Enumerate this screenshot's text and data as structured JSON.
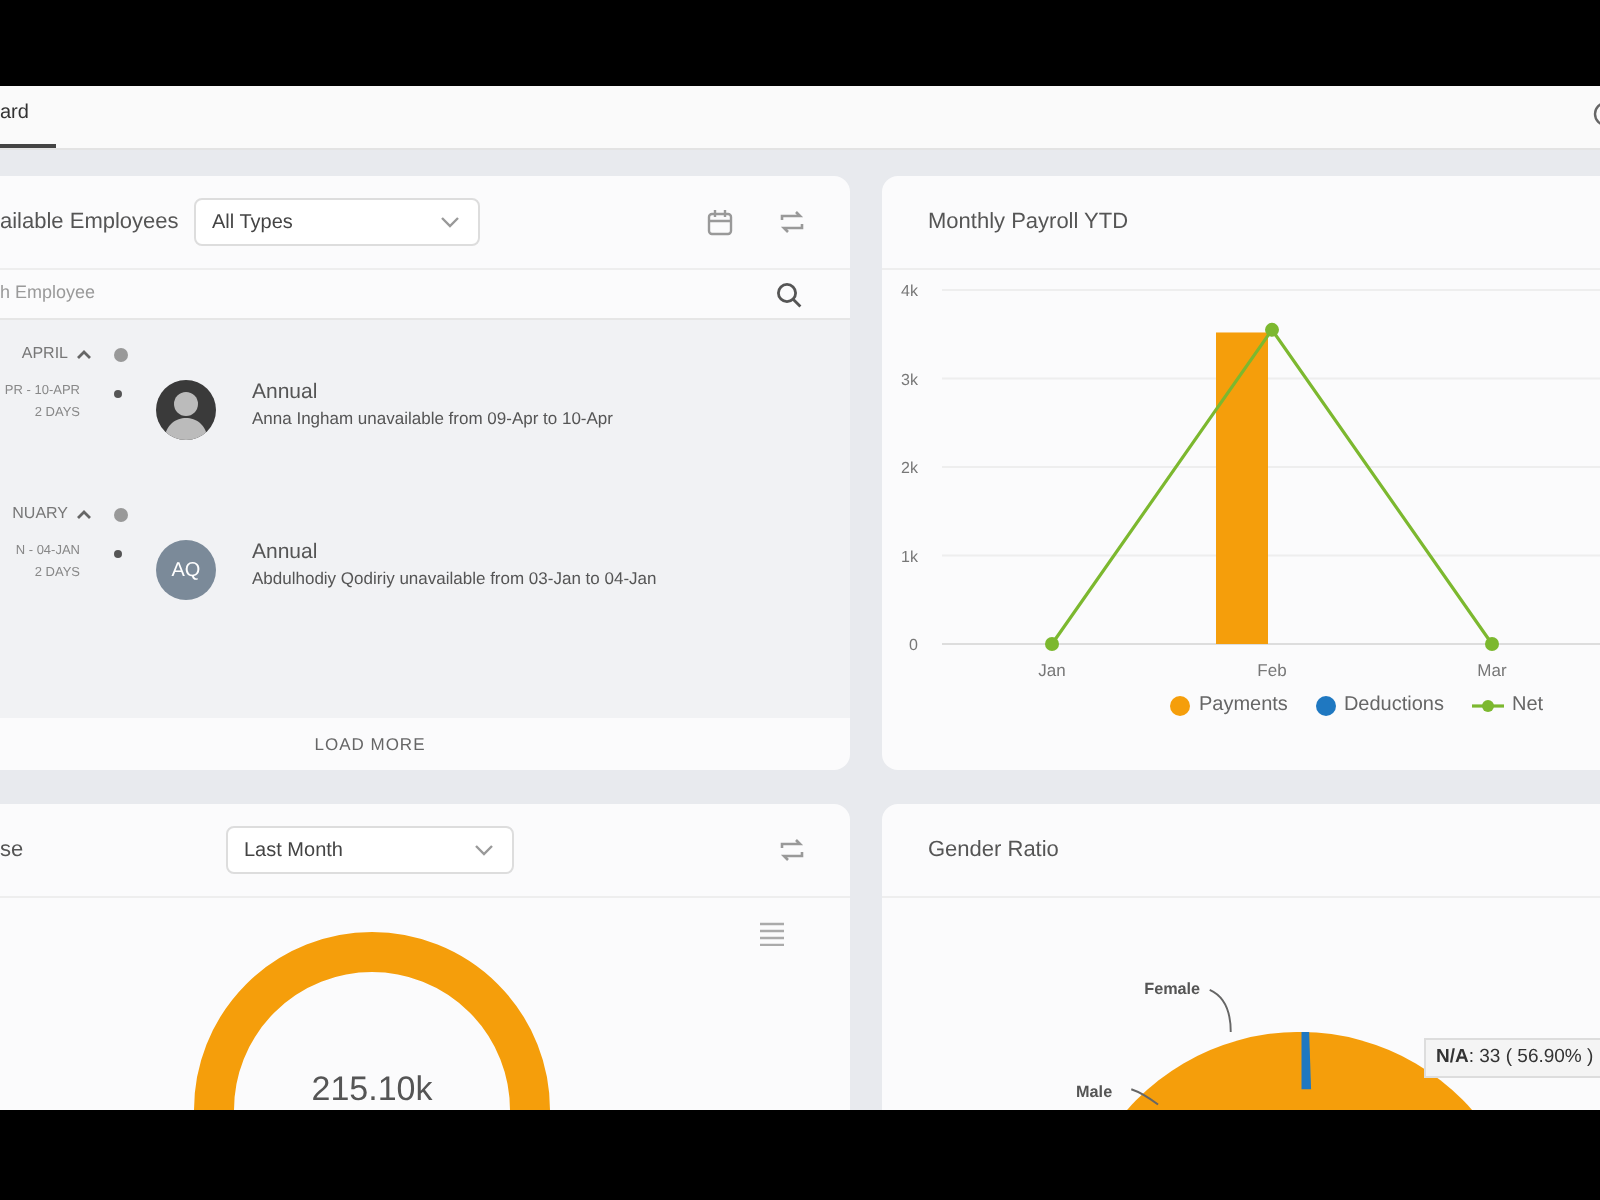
{
  "tabs": [
    {
      "label": "ard",
      "selected": true
    }
  ],
  "unavailable_card": {
    "title": "ailable Employees",
    "type_filter": {
      "value": "All Types"
    },
    "search": {
      "placeholder": "h Employee"
    },
    "groups": [
      {
        "month": "APRIL",
        "expanded": true,
        "entries": [
          {
            "dates": "PR - 10-APR",
            "duration": "2 DAYS",
            "avatar": {
              "kind": "photo"
            },
            "leave_type": "Annual",
            "description": "Anna Ingham unavailable from 09-Apr to 10-Apr"
          }
        ]
      },
      {
        "month": "NUARY",
        "expanded": true,
        "entries": [
          {
            "dates": "N - 04-JAN",
            "duration": "2 DAYS",
            "avatar": {
              "kind": "initials",
              "initials": "AQ"
            },
            "leave_type": "Annual",
            "description": "Abdulhodiy Qodiriy unavailable from 03-Jan to 04-Jan"
          }
        ]
      }
    ],
    "load_more": "LOAD MORE"
  },
  "payroll_card": {
    "title": "Monthly Payroll YTD",
    "chart_data": {
      "type": "bar",
      "categories": [
        "Jan",
        "Feb",
        "Mar"
      ],
      "series": [
        {
          "name": "Payments",
          "color": "#f59e0b",
          "values": [
            0,
            3520,
            0
          ]
        },
        {
          "name": "Deductions",
          "color": "#1f78c1",
          "values": [
            0,
            0,
            0
          ]
        },
        {
          "name": "Net",
          "type": "line",
          "marker": "circle",
          "color": "#7cb82f",
          "values": [
            0,
            3550,
            0
          ]
        }
      ],
      "grid": true,
      "ylim": [
        0,
        4000
      ],
      "yticks": [
        0,
        {
          "value": 1000,
          "label": "1k"
        },
        {
          "value": 2000,
          "label": "2k"
        },
        {
          "value": 3000,
          "label": "3k"
        },
        {
          "value": 4000,
          "label": "4k"
        }
      ]
    }
  },
  "expense_card": {
    "title": "se",
    "period_filter": {
      "value": "Last Month"
    },
    "total": "215.10k"
  },
  "gender_card": {
    "title": "Gender Ratio",
    "slice_labels": [
      "Female",
      "Male"
    ],
    "tooltip": "**N/A**: 33 ( 56.90% )"
  }
}
